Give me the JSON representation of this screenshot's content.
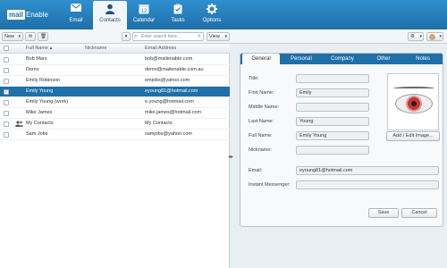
{
  "app": {
    "logo_mail": "mail",
    "logo_enable": "Enable"
  },
  "nav": [
    {
      "label": "Email",
      "icon": "envelope-icon"
    },
    {
      "label": "Contacts",
      "icon": "person-icon"
    },
    {
      "label": "Calendar",
      "icon": "calendar-icon",
      "day": "12"
    },
    {
      "label": "Tasks",
      "icon": "clipboard-icon"
    },
    {
      "label": "Options",
      "icon": "gear-icon"
    }
  ],
  "toolbar": {
    "new_label": "New",
    "view_label": "View",
    "search_placeholder": "Enter search here..."
  },
  "list": {
    "columns": {
      "name": "Full Name",
      "nickname": "Nickname",
      "email": "Email Address"
    },
    "rows": [
      {
        "name": "Bob Mars",
        "nickname": "",
        "email": "bob@mailenable.com",
        "group": false,
        "selected": false
      },
      {
        "name": "Demo",
        "nickname": "",
        "email": "demo@mailenable.com.au",
        "group": false,
        "selected": false
      },
      {
        "name": "Emily Robinson",
        "nickname": "",
        "email": "emjobs@yahoo.com",
        "group": false,
        "selected": false
      },
      {
        "name": "Emily Young",
        "nickname": "",
        "email": "eyoung81@hotmail.com",
        "group": false,
        "selected": true
      },
      {
        "name": "Emily Young (work)",
        "nickname": "",
        "email": "e.young@hotmail.com",
        "group": false,
        "selected": false
      },
      {
        "name": "Mike James",
        "nickname": "",
        "email": "mike.james@hotmail.com",
        "group": false,
        "selected": false
      },
      {
        "name": "My Contacts",
        "nickname": "",
        "email": "My Contacts",
        "group": true,
        "selected": false
      },
      {
        "name": "Sam Jobs",
        "nickname": "",
        "email": "samjobs@yahoo.com",
        "group": false,
        "selected": false
      }
    ]
  },
  "detail": {
    "tabs": [
      "General",
      "Personal",
      "Company",
      "Other",
      "Notes"
    ],
    "active_tab": "General",
    "fields": {
      "title": {
        "label": "Title:",
        "value": ""
      },
      "first_name": {
        "label": "First Name:",
        "value": "Emily"
      },
      "middle_name": {
        "label": "Middle Name:",
        "value": ""
      },
      "last_name": {
        "label": "Last Name:",
        "value": "Young"
      },
      "full_name": {
        "label": "Full Name:",
        "value": "Emily Young"
      },
      "nickname": {
        "label": "Nickname:",
        "value": ""
      },
      "email": {
        "label": "Email:",
        "value": "eyoung81@hotmail.com"
      },
      "im": {
        "label": "Instant Messenger:",
        "value": ""
      }
    },
    "photo_button": "Add / Edit Image...",
    "save_label": "Save",
    "cancel_label": "Cancel"
  },
  "colors": {
    "accent": "#1f6fa8",
    "topbar": "#2f8fcf",
    "selected_row": "#1f6fa8"
  }
}
